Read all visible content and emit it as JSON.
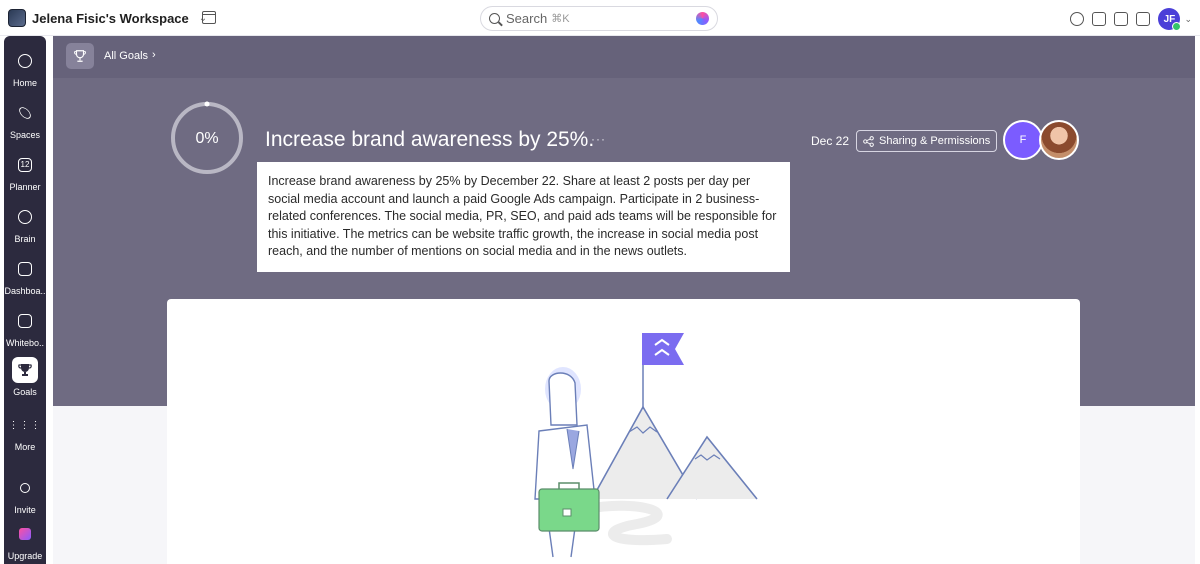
{
  "workspace": {
    "name": "Jelena Fisic's Workspace"
  },
  "search": {
    "label": "Search",
    "shortcut": "⌘K"
  },
  "user": {
    "initials": "JF"
  },
  "nav": {
    "items": [
      {
        "label": "Home",
        "icon": "home-icon"
      },
      {
        "label": "Spaces",
        "icon": "spaces-icon"
      },
      {
        "label": "Planner",
        "icon": "calendar-icon",
        "badge": "12"
      },
      {
        "label": "Brain",
        "icon": "brain-icon"
      },
      {
        "label": "Dashboa..",
        "icon": "dashboard-icon"
      },
      {
        "label": "Whitebo..",
        "icon": "whiteboard-icon"
      },
      {
        "label": "Goals",
        "icon": "trophy-icon",
        "active": true
      },
      {
        "label": "More",
        "icon": "grid-icon"
      },
      {
        "label": "Invite",
        "icon": "invite-icon"
      },
      {
        "label": "Upgrade",
        "icon": "upgrade-icon"
      }
    ]
  },
  "breadcrumb": {
    "label": "All Goals",
    "separator": "›"
  },
  "goal": {
    "progress_label": "0%",
    "progress": 0,
    "title": "Increase brand awareness by 25%.",
    "more": "···",
    "due_date": "Dec 22",
    "share_label": "Sharing & Permissions",
    "owner_initial": "F",
    "description": "Increase brand awareness by 25% by December 22. Share at least 2 posts per day per social media account and launch a paid Google Ads campaign. Participate in 2 business-related conferences. The social media, PR, SEO, and paid ads teams will be responsible for this initiative. The metrics can be website traffic growth, the increase in social media post reach, and the number of mentions on social media and in the news outlets."
  },
  "colors": {
    "hero": "#6f6b82",
    "nav": "#2c2a3e",
    "accent": "#7b5cff"
  }
}
